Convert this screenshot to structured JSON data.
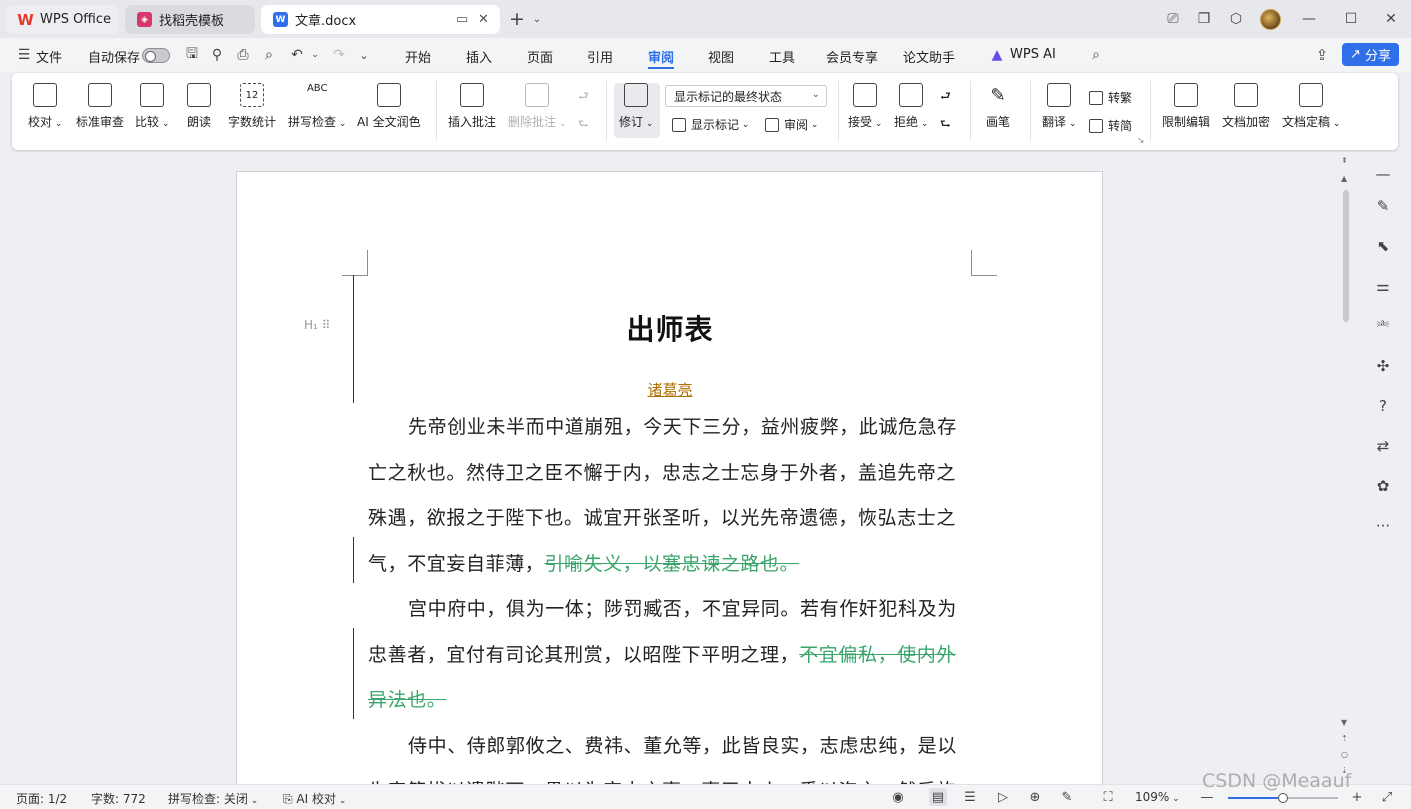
{
  "tabs": {
    "wps": "WPS Office",
    "template": "找稻壳模板",
    "document": "文章.docx"
  },
  "menu": {
    "file": "文件",
    "autosave": "自动保存",
    "items": [
      "开始",
      "插入",
      "页面",
      "引用",
      "审阅",
      "视图",
      "工具",
      "会员专享",
      "论文助手",
      "WPS AI"
    ],
    "active": "审阅",
    "share": "分享"
  },
  "ribbon": {
    "proofread": "校对",
    "standard_review": "标准审查",
    "compare": "比较",
    "read_aloud": "朗读",
    "word_count": "字数统计",
    "spell_check": "拼写检查",
    "ai_polish": "AI 全文润色",
    "insert_comment": "插入批注",
    "delete_comment": "删除批注",
    "revise": "修订",
    "markup_state": "显示标记的最终状态",
    "show_markup": "显示标记",
    "review": "审阅",
    "accept": "接受",
    "reject": "拒绝",
    "pen": "画笔",
    "translate": "翻译",
    "to_traditional": "转繁",
    "to_simplified": "转简",
    "restrict_edit": "限制编辑",
    "encrypt": "文档加密",
    "finalize": "文档定稿",
    "icon_abc": "ABC",
    "icon_num": "12"
  },
  "document": {
    "heading_marker": "H₁",
    "title": "出师表",
    "author": "诸葛亮",
    "lines": [
      {
        "indent": true,
        "text": "先帝创业未半而中道崩殂，今天下三分，益州疲弊，此诚危急存",
        "deleted": ""
      },
      {
        "indent": false,
        "text": "亡之秋也。然侍卫之臣不懈于内，忠志之士忘身于外者，盖追先帝之",
        "deleted": ""
      },
      {
        "indent": false,
        "text": "殊遇，欲报之于陛下也。诚宜开张圣听，以光先帝遗德，恢弘志士之",
        "deleted": ""
      },
      {
        "indent": false,
        "text": "气，不宜妄自菲薄，",
        "deleted": "引喻失义，以塞忠谏之路也。"
      },
      {
        "indent": true,
        "text": "宫中府中，俱为一体；陟罚臧否，不宜异同。若有作奸犯科及为",
        "deleted": ""
      },
      {
        "indent": false,
        "text": "忠善者，宜付有司论其刑赏，以昭陛下平明之理，",
        "deleted": "不宜偏私，使内外"
      },
      {
        "indent": false,
        "text": "",
        "deleted": "异法也。"
      },
      {
        "indent": true,
        "text": "侍中、侍郎郭攸之、费祎、董允等，此皆良实，志虑忠纯，是以",
        "deleted": ""
      },
      {
        "indent": false,
        "text": "先帝简拔以遗陛下。愚以为宫中之事，事无大小，悉以咨之，然后施",
        "deleted": ""
      }
    ]
  },
  "status": {
    "page": "页面: 1/2",
    "word_count": "字数: 772",
    "spell_check": "拼写检查: 关闭",
    "ai_proof": "AI 校对",
    "zoom": "109%",
    "zoom_fraction": 0.5
  },
  "watermark": "CSDN @Meaauf",
  "colors": {
    "accent": "#2f6fe9",
    "deleted_text": "#3aa56b",
    "author": "#b07000"
  }
}
